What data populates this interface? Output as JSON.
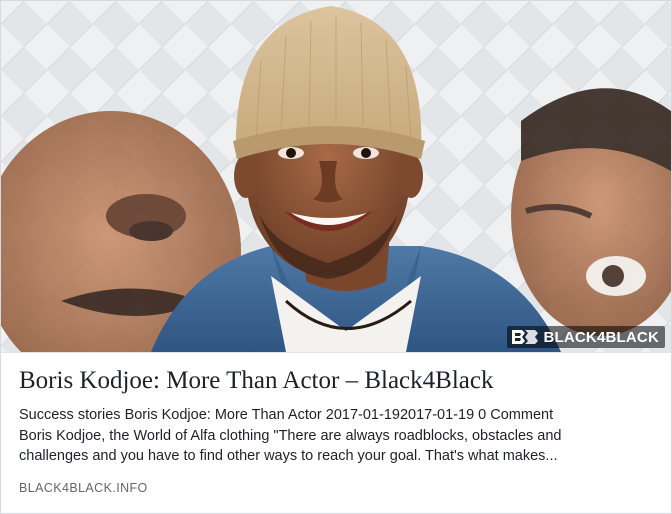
{
  "link_preview": {
    "image": {
      "alt": "Boris Kodjoe smiling in a beige beanie and denim jacket",
      "watermark": "BLACK4BLACK"
    },
    "title": "Boris Kodjoe: More Than Actor – Black4Black",
    "description_lines": [
      "Success stories Boris Kodjoe: More Than Actor 2017-01-192017-01-19 0 Comment",
      "Boris Kodjoe, the World of Alfa clothing \"There are always roadblocks, obstacles and",
      "challenges and you have to find other ways to reach your goal. That's what makes..."
    ],
    "domain": "BLACK4BLACK.INFO"
  },
  "colors": {
    "title": "#1d2129",
    "domain": "#606770",
    "border": "#d6d9de"
  }
}
